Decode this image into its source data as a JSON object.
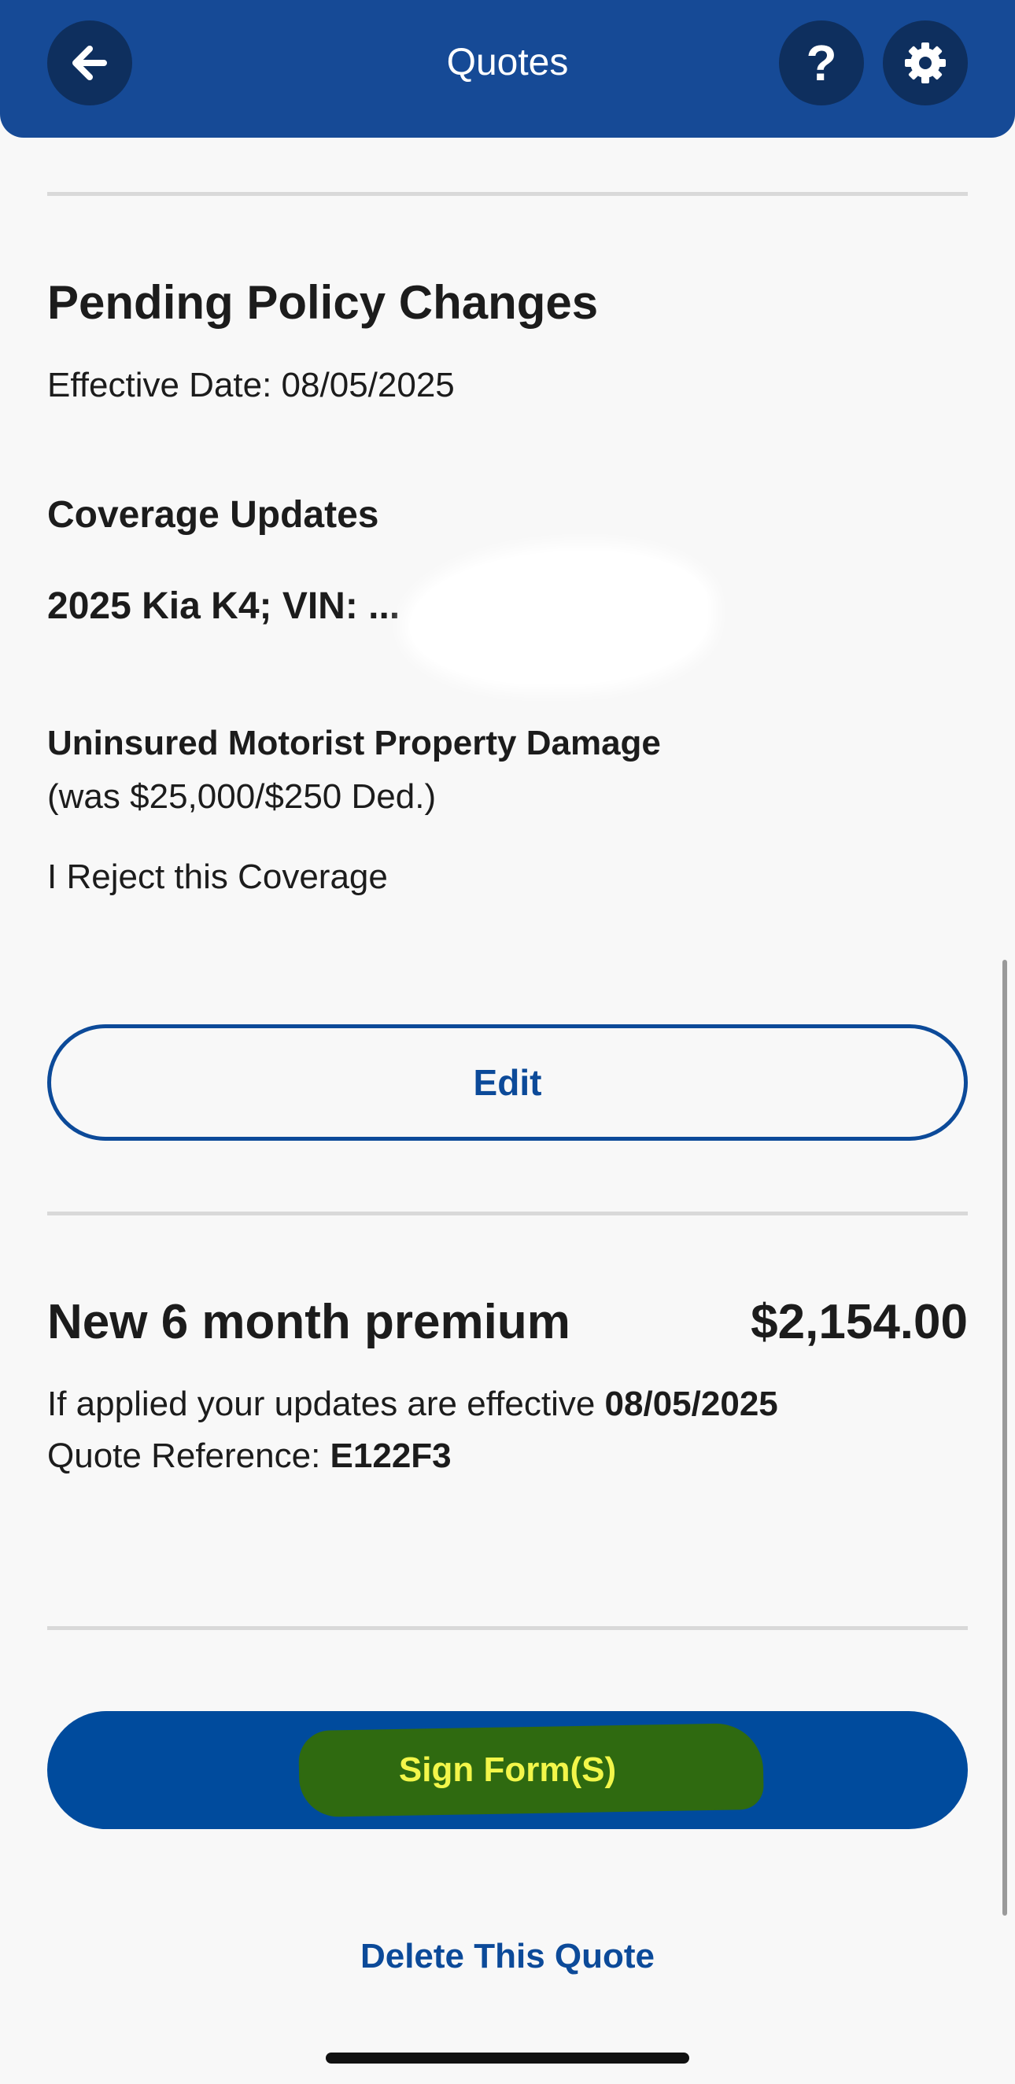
{
  "header": {
    "title": "Quotes",
    "help_glyph": "?",
    "back_icon": "arrow-left-icon",
    "help_icon": "question-mark-icon",
    "settings_icon": "gear-icon",
    "background_color": "#164a96"
  },
  "pending": {
    "title": "Pending Policy Changes",
    "effective_date": "Effective Date: 08/05/2025"
  },
  "coverage": {
    "heading": "Coverage Updates",
    "vehicle": "2025 Kia K4; VIN: ...",
    "item_name": "Uninsured Motorist Property Damage",
    "item_previous": "(was $25,000/$250 Ded.)",
    "item_selection": "I Reject this Coverage",
    "edit_label": "Edit"
  },
  "premium": {
    "label": "New 6 month premium",
    "amount": "$2,154.00",
    "applied_prefix": "If applied your updates are effective ",
    "applied_date": "08/05/2025",
    "reference_prefix": "Quote Reference: ",
    "reference_code": "E122F3"
  },
  "actions": {
    "sign_label": "Sign Form(S)",
    "delete_label": "Delete This Quote",
    "primary_color": "#004b9d",
    "link_color": "#0c4a99"
  }
}
